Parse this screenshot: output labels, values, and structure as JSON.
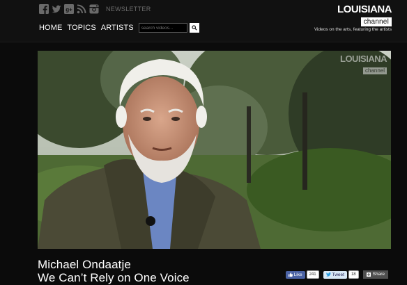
{
  "header": {
    "social_icons": [
      "facebook-icon",
      "twitter-icon",
      "google-plus-icon",
      "rss-icon",
      "instagram-icon"
    ],
    "newsletter_label": "NEWSLETTER",
    "nav": [
      {
        "label": "HOME"
      },
      {
        "label": "TOPICS"
      },
      {
        "label": "ARTISTS"
      }
    ],
    "search_placeholder": "search videos...",
    "logo_top": "LOUISIANA",
    "logo_bottom": "channel",
    "tagline": "Videos on the arts, featuring the artists"
  },
  "video": {
    "watermark_top": "LOUISIANA",
    "watermark_bottom": "channel"
  },
  "content": {
    "name": "Michael Ondaatje",
    "title": "We Can’t Rely on One Voice"
  },
  "share": {
    "like_label": "Like",
    "like_count": "241",
    "tweet_label": "Tweet",
    "tweet_count": "18",
    "share_label": "Share"
  },
  "colors": {
    "background": "#0b0b0b",
    "header": "#111111",
    "facebook": "#4a62a4"
  }
}
